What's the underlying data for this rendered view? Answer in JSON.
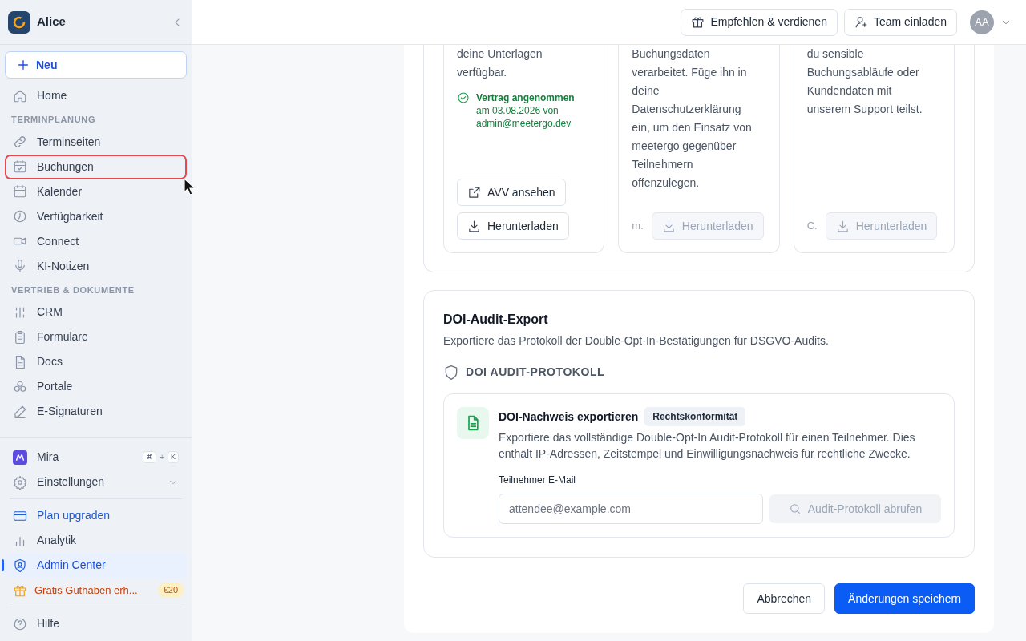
{
  "workspace": {
    "name": "Alice"
  },
  "new_button": {
    "label": "Neu"
  },
  "sidebar": {
    "items": [
      {
        "kind": "item",
        "label": "Home",
        "selected": false,
        "highlighted": false
      },
      {
        "kind": "section",
        "label": "TERMINPLANUNG"
      },
      {
        "kind": "item",
        "label": "Terminseiten",
        "selected": false,
        "highlighted": false
      },
      {
        "kind": "item",
        "label": "Buchungen",
        "selected": false,
        "highlighted": true
      },
      {
        "kind": "item",
        "label": "Kalender",
        "selected": false,
        "highlighted": false
      },
      {
        "kind": "item",
        "label": "Verfügbarkeit",
        "selected": false,
        "highlighted": false
      },
      {
        "kind": "item",
        "label": "Connect",
        "selected": false,
        "highlighted": false
      },
      {
        "kind": "item",
        "label": "KI-Notizen",
        "selected": false,
        "highlighted": false
      },
      {
        "kind": "section",
        "label": "VERTRIEB & DOKUMENTE"
      },
      {
        "kind": "item",
        "label": "CRM",
        "selected": false,
        "highlighted": false
      },
      {
        "kind": "item",
        "label": "Formulare",
        "selected": false,
        "highlighted": false
      },
      {
        "kind": "item",
        "label": "Docs",
        "selected": false,
        "highlighted": false
      },
      {
        "kind": "item",
        "label": "Portale",
        "selected": false,
        "highlighted": false
      },
      {
        "kind": "item",
        "label": "E-Signaturen",
        "selected": false,
        "highlighted": false
      }
    ],
    "bottom_items": [
      {
        "kind": "assistant",
        "label": "Mira",
        "shortcut": [
          "⌘",
          "+",
          "K"
        ]
      },
      {
        "kind": "expandable",
        "label": "Einstellungen",
        "expanded": false
      },
      {
        "kind": "divider"
      },
      {
        "kind": "upgrade",
        "label": "Plan upgraden",
        "selected": false
      },
      {
        "kind": "item",
        "label": "Analytik",
        "selected": false
      },
      {
        "kind": "item",
        "label": "Admin Center",
        "selected": true
      },
      {
        "kind": "promo",
        "label": "Gratis Guthaben erh...",
        "badge": "€20",
        "selected": false
      },
      {
        "kind": "divider"
      },
      {
        "kind": "item",
        "label": "Hilfe",
        "selected": false
      }
    ]
  },
  "header": {
    "buttons": [
      "Empfehlen & verdienen",
      "Team einladen"
    ],
    "avatar": "AA"
  },
  "documents": [
    {
      "lines": [
        "deine Unterlagen",
        "verfügbar."
      ],
      "status": {
        "title": "Vertrag angenommen",
        "detail": "am 03.08.2026 von admin@meetergo.dev"
      },
      "actions": [
        {
          "kind": "external",
          "label": "AVV ansehen",
          "disabled": false
        },
        {
          "kind": "download",
          "label": "Herunterladen",
          "disabled": false
        }
      ]
    },
    {
      "lines": [
        "Buchungsdaten",
        "verarbeitet. Füge ihn in",
        "deine",
        "Datenschutzerklärung",
        "ein, um den Einsatz von",
        "meetergo gegenüber",
        "Teilnehmern",
        "offenzulegen."
      ],
      "footnote": "m.",
      "actions": [
        {
          "kind": "download",
          "label": "Herunterladen",
          "disabled": true
        }
      ]
    },
    {
      "lines": [
        "du sensible",
        "Buchungsabläufe oder",
        "Kundendaten mit",
        "unserem Support teilst."
      ],
      "footnote": "C.",
      "actions": [
        {
          "kind": "download",
          "label": "Herunterladen",
          "disabled": true
        }
      ]
    }
  ],
  "doi_section": {
    "title": "DOI-Audit-Export",
    "description": "Exportiere das Protokoll der Double-Opt-In-Bestätigungen für DSGVO-Audits.",
    "subheading": "DOI AUDIT-PROTOKOLL",
    "card": {
      "title": "DOI-Nachweis exportieren",
      "tag": "Rechtskonformität",
      "description": "Exportiere das vollständige Double-Opt-In Audit-Protokoll für einen Teilnehmer. Dies enthält IP-Adressen, Zeitstempel und Einwilligungsnachweis für rechtliche Zwecke.",
      "field_label": "Teilnehmer E-Mail",
      "placeholder": "attendee@example.com",
      "button": {
        "label": "Audit-Protokoll abrufen",
        "disabled": true
      }
    }
  },
  "footer_buttons": [
    {
      "kind": "secondary",
      "label": "Abbrechen"
    },
    {
      "kind": "primary",
      "label": "Änderungen speichern"
    }
  ]
}
